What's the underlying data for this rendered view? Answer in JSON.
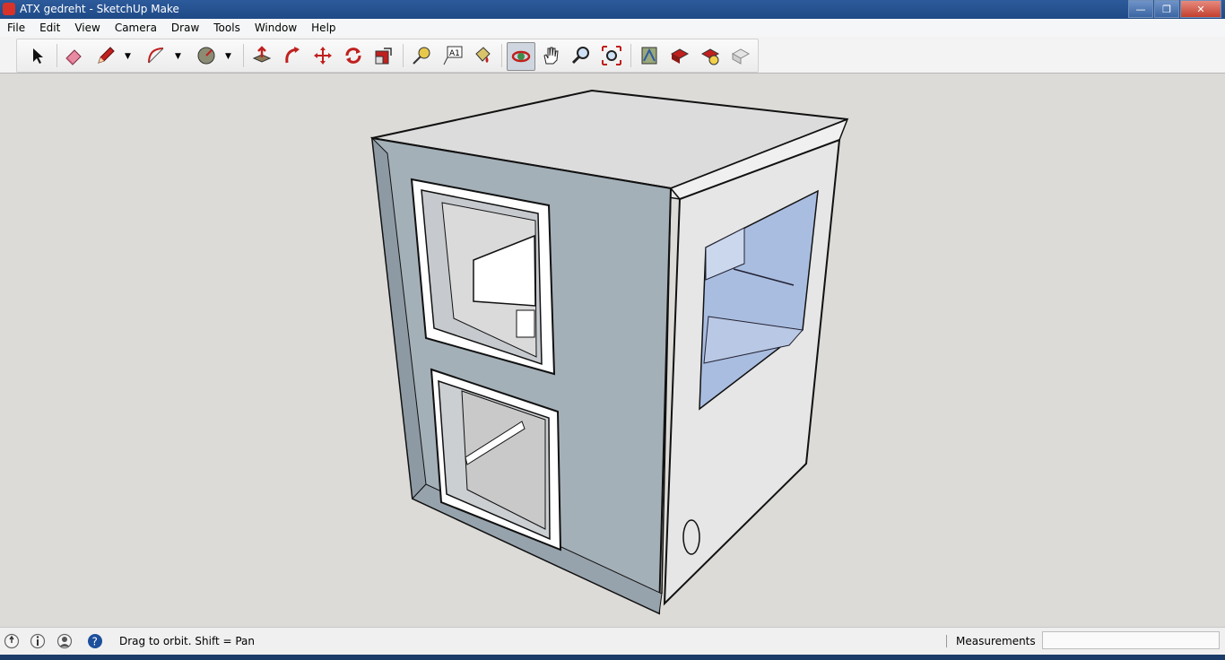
{
  "window": {
    "title": "ATX gedreht - SketchUp Make"
  },
  "menu": [
    "File",
    "Edit",
    "View",
    "Camera",
    "Draw",
    "Tools",
    "Window",
    "Help"
  ],
  "toolbar": {
    "tools": [
      {
        "icon": "select-arrow-icon"
      },
      {
        "icon": "eraser-icon"
      },
      {
        "icon": "pencil-icon"
      },
      {
        "icon": "arc-icon"
      },
      {
        "icon": "circle-icon"
      },
      {
        "icon": "push-pull-icon"
      },
      {
        "icon": "follow-me-icon"
      },
      {
        "icon": "move-icon"
      },
      {
        "icon": "rotate-icon"
      },
      {
        "icon": "scale-icon"
      },
      {
        "icon": "tape-measure-icon"
      },
      {
        "icon": "text-icon"
      },
      {
        "icon": "paint-bucket-icon"
      },
      {
        "icon": "orbit-icon",
        "active": true
      },
      {
        "icon": "pan-icon"
      },
      {
        "icon": "zoom-icon"
      },
      {
        "icon": "zoom-extents-icon"
      },
      {
        "icon": "warehouse-icon"
      },
      {
        "icon": "share-model-icon"
      },
      {
        "icon": "get-components-icon"
      },
      {
        "icon": "extension-icon"
      }
    ],
    "text_tool_label": "A1"
  },
  "status": {
    "hint": "Drag to orbit.  Shift = Pan",
    "measurements_label": "Measurements",
    "measurements_value": ""
  },
  "colors": {
    "title_bar": "#1f4a87",
    "front_face": "#a4b0b8",
    "side_face": "#e6e6e6",
    "top_face": "#dcdcdc",
    "glass": "#a9bde0",
    "background": "#dddbd7"
  }
}
